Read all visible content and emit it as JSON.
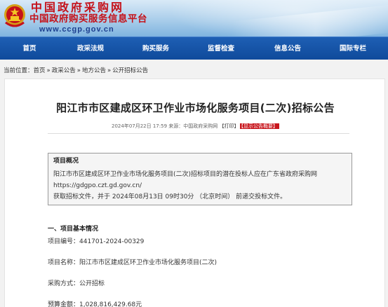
{
  "header": {
    "title": "中国政府采购网",
    "subtitle": "中国政府购买服务信息平台",
    "url": "www.ccgp.gov.cn"
  },
  "nav": {
    "items": [
      "首页",
      "政采法规",
      "购买服务",
      "监督检查",
      "信息公告",
      "国际专栏"
    ]
  },
  "breadcrumb": {
    "prefix": "当前位置：",
    "items": [
      "首页",
      "政采公告",
      "地方公告",
      "公开招标公告"
    ],
    "separator": "»"
  },
  "article": {
    "title": "阳江市市区建成区环卫作业市场化服务项目(二次)招标公告",
    "date": "2024年07月22日 17:59",
    "source_label": "来源：",
    "source": "中国政府采购网",
    "print_label": "【打印】",
    "badge": "【显示公告概要】"
  },
  "summary": {
    "title": "项目概况",
    "lines": [
      "阳江市市区建成区环卫作业市场化服务项目(二次)招标项目的潜在投标人应在广东省政府采购网",
      "https://gdgpo.czt.gd.gov.cn/",
      "获取招标文件，并于 2024年08月13日 09时30分 （北京时间） 前递交投标文件。"
    ]
  },
  "section": {
    "title": "一、项目基本情况",
    "fields": [
      "项目编号：441701-2024-00329",
      "项目名称：阳江市市区建成区环卫作业市场化服务项目(二次)",
      "采购方式：公开招标",
      "预算金额：1,028,816,429.68元"
    ]
  },
  "colors": {
    "brand_red": "#c5121a",
    "nav_blue": "#0f4a9b",
    "badge_red": "#c8161d"
  }
}
